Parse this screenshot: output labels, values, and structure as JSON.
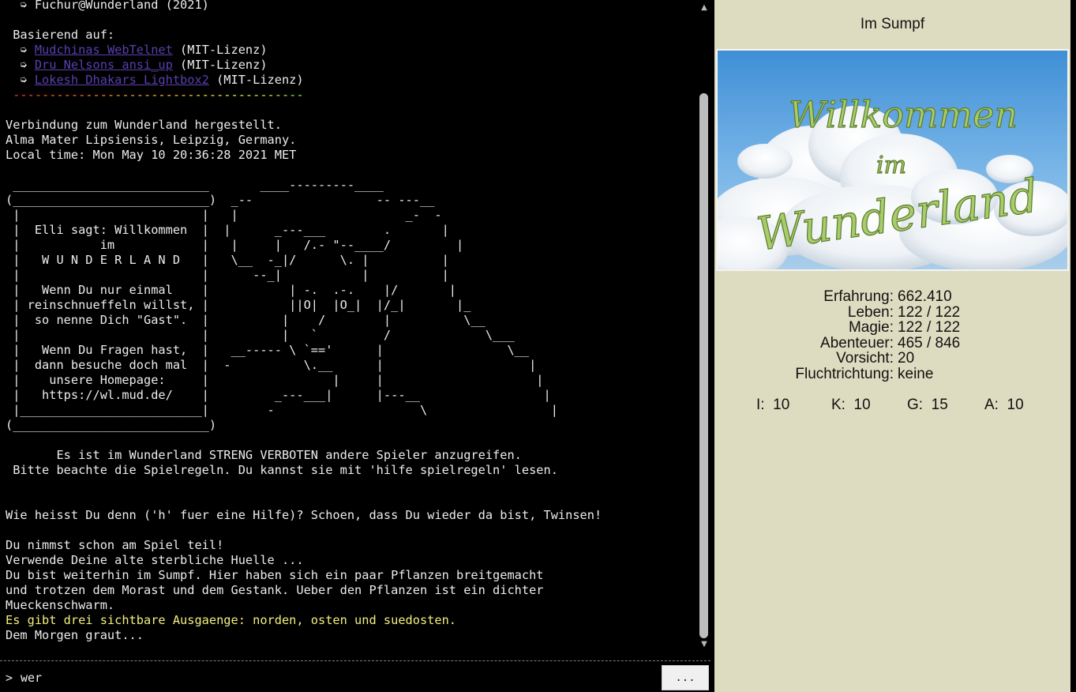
{
  "terminal": {
    "lines": [
      {
        "text": "  ➭ Fuchur@Wunderland (2021)"
      },
      {
        "text": ""
      },
      {
        "text": " Basierend auf:"
      },
      {
        "parts": [
          {
            "t": "  ➭ "
          },
          {
            "t": "Mudchinas WebTelnet",
            "c": "link"
          },
          {
            "t": " (MIT-Lizenz)"
          }
        ]
      },
      {
        "parts": [
          {
            "t": "  ➭ "
          },
          {
            "t": "Dru Nelsons ansi_up",
            "c": "link"
          },
          {
            "t": " (MIT-Lizenz)"
          }
        ]
      },
      {
        "parts": [
          {
            "t": "  ➭ "
          },
          {
            "t": "Lokesh Dhakars Lightbox2",
            "c": "link"
          },
          {
            "t": " (MIT-Lizenz)"
          }
        ]
      },
      {
        "text": " ----------------------------------------",
        "c": "rainbow"
      },
      {
        "text": ""
      },
      {
        "text": "Verbindung zum Wunderland hergestellt."
      },
      {
        "text": "Alma Mater Lipsiensis, Leipzig, Germany."
      },
      {
        "text": "Local time: Mon May 10 20:36:28 2021 MET"
      },
      {
        "text": ""
      },
      {
        "text": " ___________________________       ____---------____"
      },
      {
        "text": "(___________________________)  _--                 -- ---__"
      },
      {
        "text": " |                         |   |                       _-  -"
      },
      {
        "text": " |  Elli sagt: Willkommen  |  |      _---___        .       |"
      },
      {
        "text": " |           im            |   |     |   /.- \"--____/         |"
      },
      {
        "text": " |   W U N D E R L A N D   |   \\__  -_|/      \\. |          |"
      },
      {
        "text": " |                         |      --_|           |          |"
      },
      {
        "text": " |   Wenn Du nur einmal    |           | -.  .-.    |/       |"
      },
      {
        "text": " | reinschnueffeln willst, |           ||O|  |O_|  |/_|       |_"
      },
      {
        "text": " |  so nenne Dich \"Gast\".  |          |    /        |          \\__"
      },
      {
        "text": " |                         |          |   `         /             \\___"
      },
      {
        "text": " |   Wenn Du Fragen hast,  |   __----- \\ `=='      |                 \\__"
      },
      {
        "text": " |  dann besuche doch mal  |  -          \\.__      |                    |"
      },
      {
        "text": " |    unsere Homepage:     |                 |     |                     |"
      },
      {
        "text": " |   https://wl.mud.de/    |         _---___|      |---__                 |"
      },
      {
        "text": " |_________________________|        -                    \\                 |"
      },
      {
        "text": "(___________________________)"
      },
      {
        "text": ""
      },
      {
        "text": "       Es ist im Wunderland STRENG VERBOTEN andere Spieler anzugreifen."
      },
      {
        "text": " Bitte beachte die Spielregeln. Du kannst sie mit 'hilfe spielregeln' lesen."
      },
      {
        "text": ""
      },
      {
        "text": ""
      },
      {
        "text": "Wie heisst Du denn ('h' fuer eine Hilfe)? Schoen, dass Du wieder da bist, Twinsen!"
      },
      {
        "text": ""
      },
      {
        "text": "Du nimmst schon am Spiel teil!"
      },
      {
        "text": "Verwende Deine alte sterbliche Huelle ..."
      },
      {
        "text": "Du bist weiterhin im Sumpf. Hier haben sich ein paar Pflanzen breitgemacht"
      },
      {
        "text": "und trotzen dem Morast und dem Gestank. Ueber den Pflanzen ist ein dichter"
      },
      {
        "text": "Mueckenschwarm."
      },
      {
        "text": "Es gibt drei sichtbare Ausgaenge: norden, osten und suedosten.",
        "c": "yellow"
      },
      {
        "text": "Dem Morgen graut..."
      }
    ]
  },
  "input": {
    "prompt": ">",
    "value": "wer",
    "more_label": "..."
  },
  "scrollbar": {
    "up_icon": "▲",
    "down_icon": "▼"
  },
  "sidepanel": {
    "room_title": "Im Sumpf",
    "banner": {
      "line1": "Willkommen",
      "line2": "im",
      "line3": "Wunderland"
    },
    "stats": [
      {
        "label": "Erfahrung:",
        "value": "662.410"
      },
      {
        "label": "Leben:",
        "value": "122 / 122"
      },
      {
        "label": "Magie:",
        "value": "122 / 122"
      },
      {
        "label": "Abenteuer:",
        "value": "465 / 846"
      },
      {
        "label": "Vorsicht:",
        "value": "20"
      },
      {
        "label": "Fluchtrichtung:",
        "value": "keine"
      }
    ],
    "attributes": [
      {
        "label": "I:",
        "value": "10"
      },
      {
        "label": "K:",
        "value": "10"
      },
      {
        "label": "G:",
        "value": "15"
      },
      {
        "label": "A:",
        "value": "10"
      }
    ]
  },
  "colors": {
    "panel_bg": "#dedcc0",
    "terminal_bg": "#000000",
    "terminal_text": "#ececec",
    "link": "#5a3fb0",
    "exits_yellow": "#f3f080",
    "banner_text_green": "#9cc25a"
  }
}
